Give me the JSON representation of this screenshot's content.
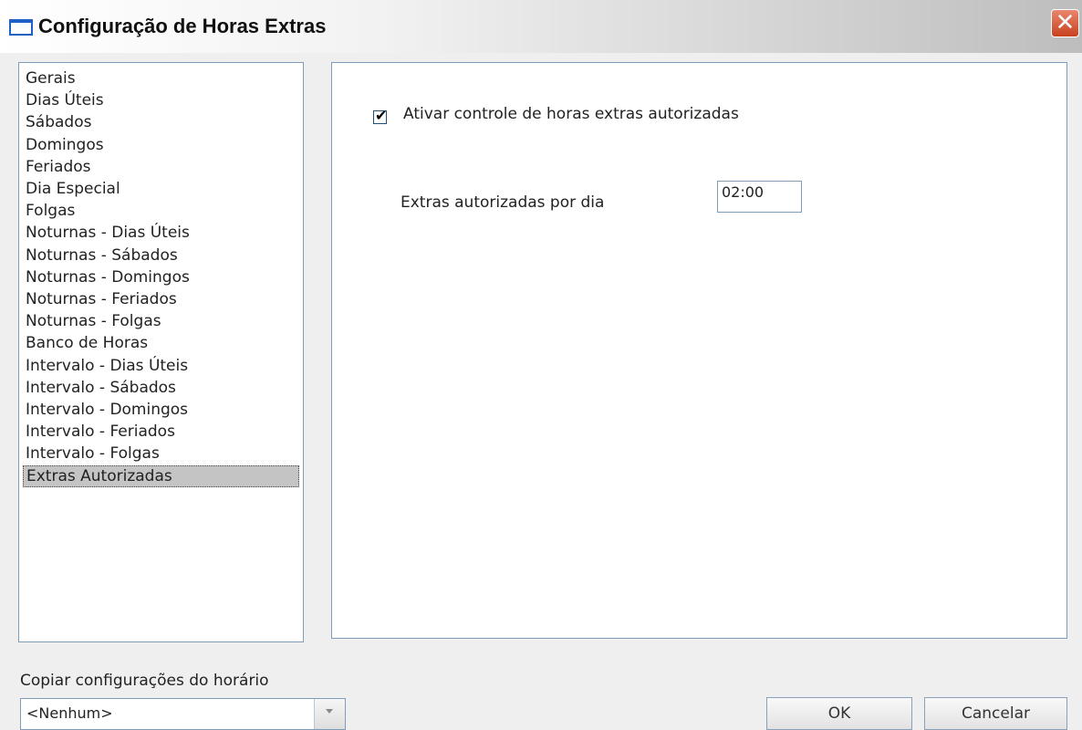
{
  "window": {
    "title": "Configuração de Horas Extras",
    "close_symbol": "✕"
  },
  "sidebar": {
    "items": [
      "Gerais",
      "Dias Úteis",
      "Sábados",
      "Domingos",
      "Feriados",
      "Dia Especial",
      "Folgas",
      "Noturnas - Dias Úteis",
      "Noturnas - Sábados",
      "Noturnas - Domingos",
      "Noturnas - Feriados",
      "Noturnas - Folgas",
      "Banco de Horas",
      "Intervalo - Dias Úteis",
      "Intervalo - Sábados",
      "Intervalo - Domingos",
      "Intervalo - Feriados",
      "Intervalo - Folgas",
      "Extras Autorizadas"
    ],
    "selected_index": 18
  },
  "panel": {
    "enable_checkbox_label": "Ativar controle de horas extras autorizadas",
    "enable_checked": true,
    "extras_label": "Extras autorizadas por dia",
    "extras_value": "02:00"
  },
  "footer": {
    "copy_label": "Copiar configurações do horário",
    "copy_selected": "<Nenhum>",
    "ok_label": "OK",
    "cancel_label": "Cancelar"
  }
}
